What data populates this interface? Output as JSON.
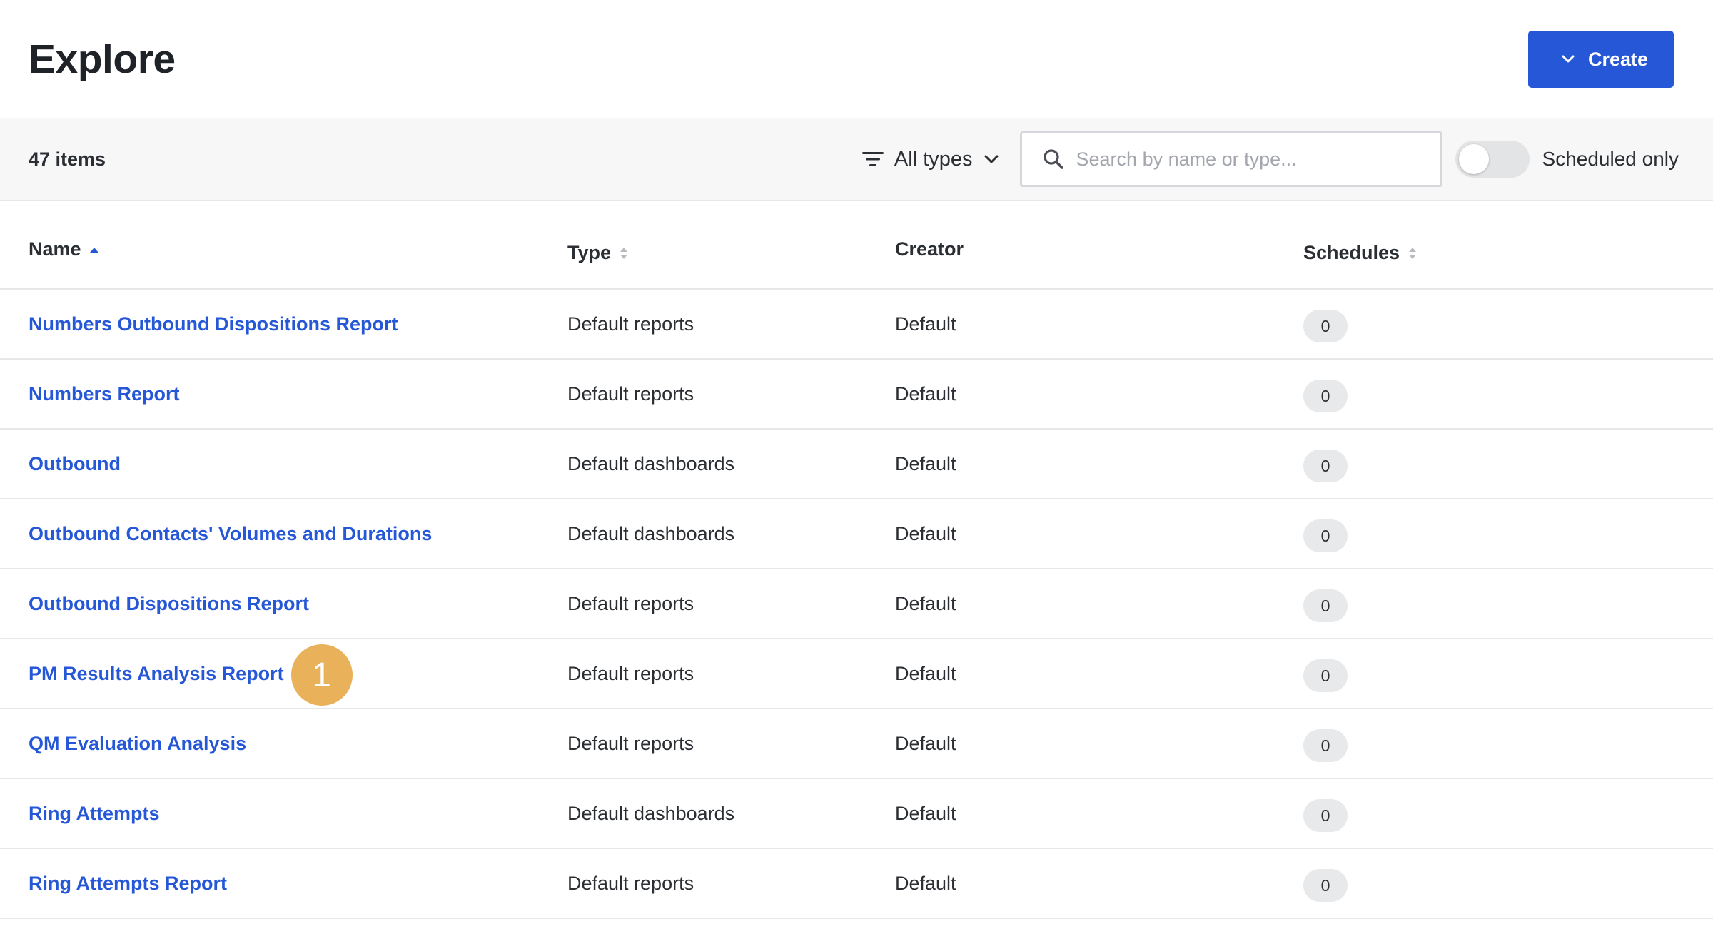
{
  "header": {
    "title": "Explore",
    "create_label": "Create"
  },
  "toolbar": {
    "item_count": "47 items",
    "filter_label": "All types",
    "search_placeholder": "Search by name or type...",
    "search_value": "",
    "toggle_label": "Scheduled only",
    "toggle_on": false
  },
  "table": {
    "columns": {
      "name": "Name",
      "type": "Type",
      "creator": "Creator",
      "schedules": "Schedules"
    },
    "rows": [
      {
        "name": "Numbers Outbound Dispositions Report",
        "type": "Default reports",
        "creator": "Default",
        "schedules": "0"
      },
      {
        "name": "Numbers Report",
        "type": "Default reports",
        "creator": "Default",
        "schedules": "0"
      },
      {
        "name": "Outbound",
        "type": "Default dashboards",
        "creator": "Default",
        "schedules": "0"
      },
      {
        "name": "Outbound Contacts' Volumes and Durations",
        "type": "Default dashboards",
        "creator": "Default",
        "schedules": "0"
      },
      {
        "name": "Outbound Dispositions Report",
        "type": "Default reports",
        "creator": "Default",
        "schedules": "0"
      },
      {
        "name": "PM Results Analysis Report",
        "type": "Default reports",
        "creator": "Default",
        "schedules": "0",
        "marker": "1"
      },
      {
        "name": "QM Evaluation Analysis",
        "type": "Default reports",
        "creator": "Default",
        "schedules": "0"
      },
      {
        "name": "Ring Attempts",
        "type": "Default dashboards",
        "creator": "Default",
        "schedules": "0"
      },
      {
        "name": "Ring Attempts Report",
        "type": "Default reports",
        "creator": "Default",
        "schedules": "0"
      }
    ]
  },
  "colors": {
    "accent": "#2557d6",
    "marker": "#e9b15a",
    "toolbar_bg": "#f7f7f8"
  }
}
